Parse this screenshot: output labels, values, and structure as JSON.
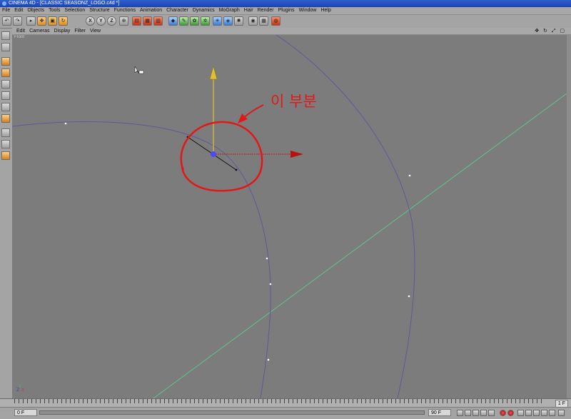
{
  "window": {
    "title": "CINEMA 4D - [CLASSIC SEASONZ_LOGO.c4d *]"
  },
  "menu": [
    "File",
    "Edit",
    "Objects",
    "Tools",
    "Selection",
    "Structure",
    "Functions",
    "Animation",
    "Character",
    "Dynamics",
    "MoGraph",
    "Hair",
    "Render",
    "Plugins",
    "Window",
    "Help"
  ],
  "toolbar": {
    "icons": [
      "undo-icon",
      "redo-icon",
      "select-icon",
      "move-icon",
      "scale-icon",
      "rotate-icon",
      "x-axis-icon",
      "y-axis-icon",
      "z-axis-icon",
      "coord-system-icon",
      "render-view-icon",
      "render-picture-icon",
      "render-settings-icon",
      "cube-icon",
      "spline-pen-icon",
      "nurbs-icon",
      "array-icon",
      "deformer-icon",
      "scene-icon",
      "light-icon",
      "camera-icon",
      "null-icon",
      "floor-icon",
      "paint-icon"
    ],
    "axis_labels": {
      "x": "X",
      "y": "Y",
      "z": "Z"
    }
  },
  "view_menu": [
    "Edit",
    "Cameras",
    "Display",
    "Filter",
    "View"
  ],
  "viewport": {
    "label": "Front",
    "annotation_text": "이 부분",
    "colors": {
      "background": "#7c7c7c",
      "spline": "#5d5a9a",
      "annotation": "#e01818",
      "x_axis": "#c01818",
      "y_axis": "#e0c030",
      "grid": "#5fc48a"
    }
  },
  "timeline": {
    "frame_value": "1 F",
    "end": "90"
  },
  "transport": {
    "current": "0 F",
    "max": "90 F"
  }
}
